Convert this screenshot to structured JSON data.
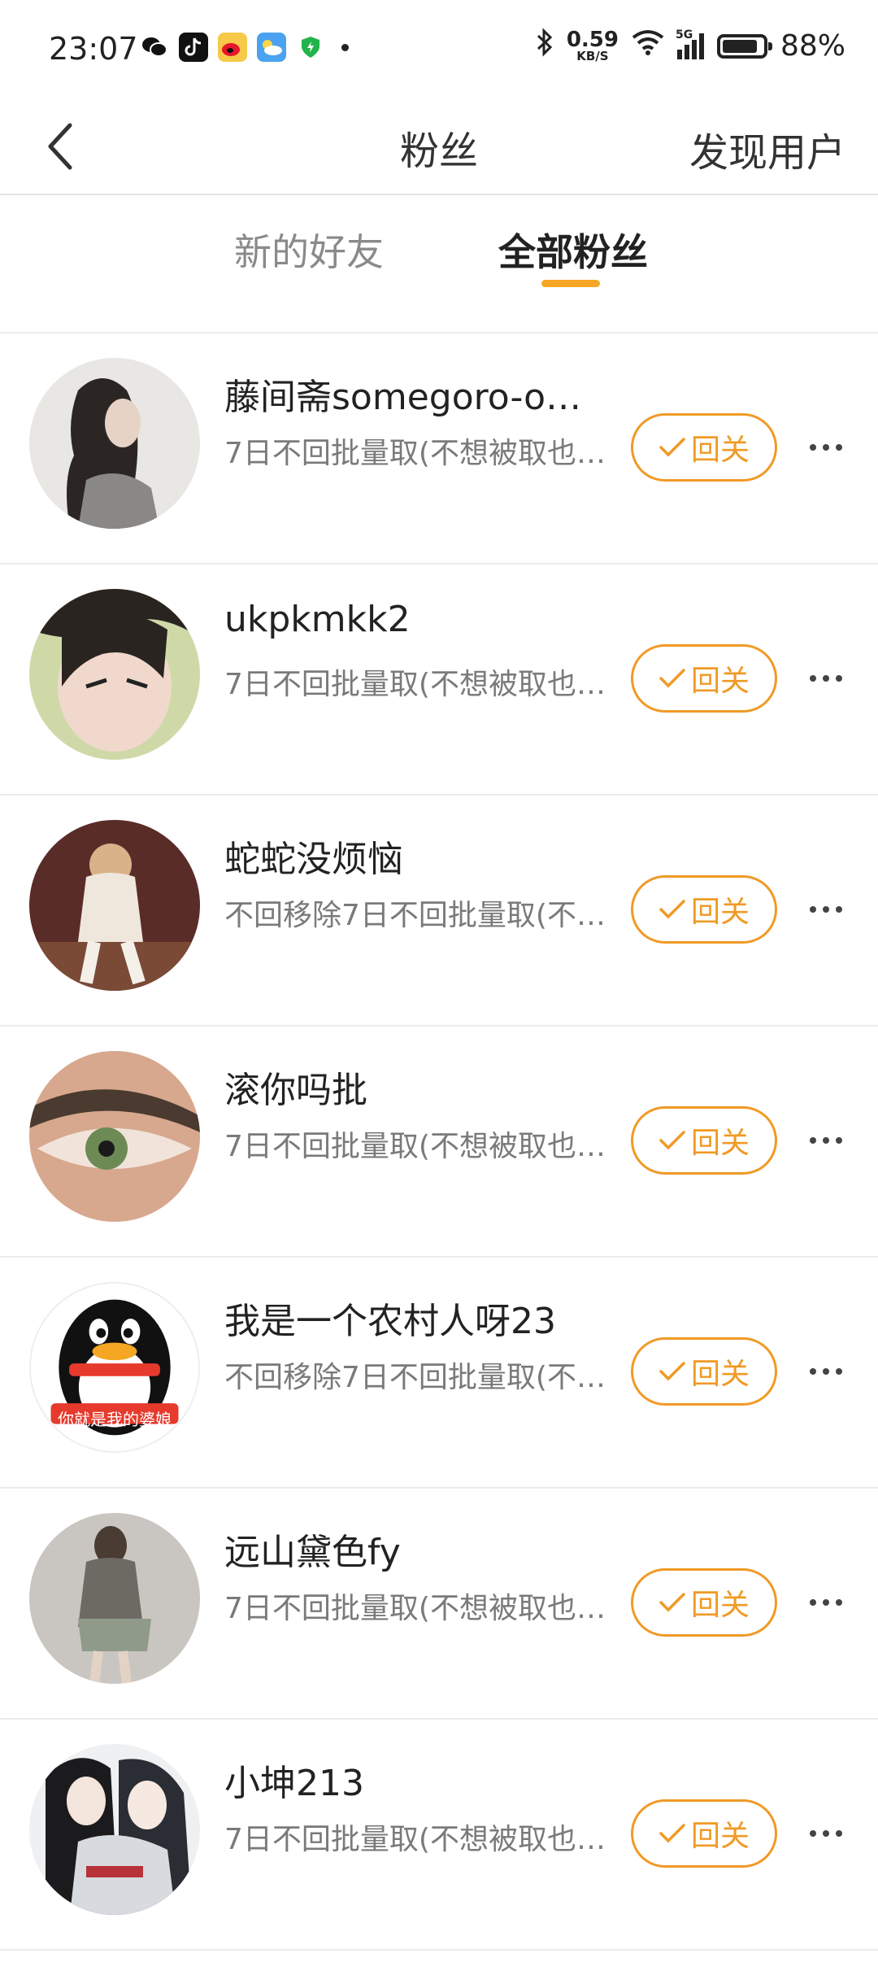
{
  "status_bar": {
    "time": "23:07",
    "net_speed_value": "0.59",
    "net_speed_unit": "KB/S",
    "signal_label": "5G",
    "battery": "88%",
    "battery_level": 0.88,
    "app_icons": [
      "wechat-icon",
      "tiktok-icon",
      "weibo-icon",
      "weather-icon",
      "security-shield-icon"
    ]
  },
  "nav": {
    "title": "粉丝",
    "discover_label": "发现用户"
  },
  "tabs": [
    {
      "label": "新的好友",
      "active": false
    },
    {
      "label": "全部粉丝",
      "active": true
    }
  ],
  "colors": {
    "accent": "#f09a25",
    "tab_indicator": "#f5a623"
  },
  "followers": [
    {
      "name": "藤间斋somegoro-offi…",
      "desc": "7日不回批量取(不想被取也…",
      "button": "回关",
      "avatar": "avatar-woman-dark-hair"
    },
    {
      "name": "ukpkmkk2",
      "desc": "7日不回批量取(不想被取也…",
      "button": "回关",
      "avatar": "avatar-anime-boy"
    },
    {
      "name": "蛇蛇没烦恼",
      "desc": "不回移除7日不回批量取(不…",
      "button": "回关",
      "avatar": "avatar-girl-photo"
    },
    {
      "name": "滚你吗批",
      "desc": "7日不回批量取(不想被取也…",
      "button": "回关",
      "avatar": "avatar-eye-closeup"
    },
    {
      "name": "我是一个农村人呀23",
      "desc": "不回移除7日不回批量取(不…",
      "button": "回关",
      "avatar": "avatar-penguin",
      "avatar_text": "你就是我的婆娘"
    },
    {
      "name": "远山黛色fy",
      "desc": "7日不回批量取(不想被取也…",
      "button": "回关",
      "avatar": "avatar-fashion-photo"
    },
    {
      "name": "小坤213",
      "desc": "7日不回批量取(不想被取也…",
      "button": "回关",
      "avatar": "avatar-anime-couple"
    }
  ]
}
